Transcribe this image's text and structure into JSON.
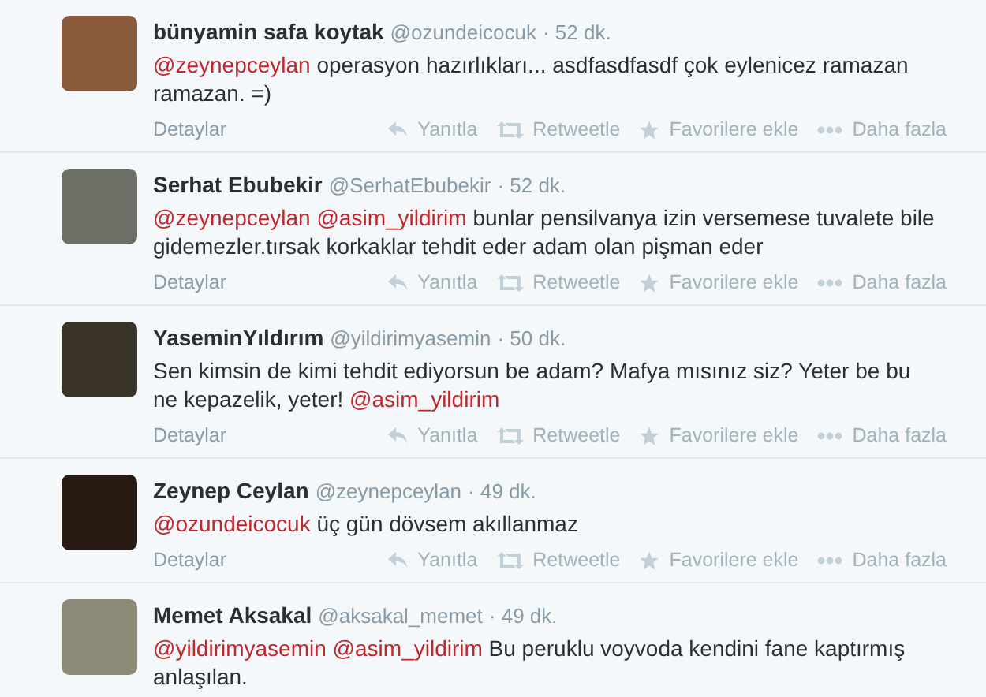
{
  "tweets": [
    {
      "name": "bünyamin safa koytak",
      "handle": "@ozundeicocuk",
      "time": "· 52 dk.",
      "body": [
        {
          "kind": "mention",
          "text": "@zeynepceylan"
        },
        {
          "kind": "text",
          "text": "operasyon hazırlıkları... asdfasdfasdf çok eylenicez ramazan ramazan. =)"
        }
      ],
      "details": "Detaylar",
      "actions": [
        {
          "kind": "reply",
          "label": "Yanıtla"
        },
        {
          "kind": "retweet",
          "label": "Retweetle"
        },
        {
          "kind": "favorite",
          "label": "Favorilere ekle"
        },
        {
          "kind": "more",
          "label": "Daha fazla"
        }
      ]
    },
    {
      "name": "Serhat Ebubekir",
      "handle": "@SerhatEbubekir",
      "time": "· 52 dk.",
      "body": [
        {
          "kind": "mention",
          "text": "@zeynepceylan"
        },
        {
          "kind": "mention",
          "text": "@asim_yildirim"
        },
        {
          "kind": "text",
          "text": "bunlar pensilvanya izin versemese tuvalete bile gidemezler.tırsak korkaklar tehdit eder adam olan pişman eder"
        }
      ],
      "details": "Detaylar",
      "actions": [
        {
          "kind": "reply",
          "label": "Yanıtla"
        },
        {
          "kind": "retweet",
          "label": "Retweetle"
        },
        {
          "kind": "favorite",
          "label": "Favorilere ekle"
        },
        {
          "kind": "more",
          "label": "Daha fazla"
        }
      ]
    },
    {
      "name": "YaseminYıldırım",
      "handle": "@yildirimyasemin",
      "time": "· 50 dk.",
      "body": [
        {
          "kind": "text",
          "text": "Sen kimsin de kimi tehdit ediyorsun be adam? Mafya mısınız siz? Yeter be bu ne kepazelik, yeter!"
        },
        {
          "kind": "mention",
          "text": "@asim_yildirim"
        }
      ],
      "details": "Detaylar",
      "actions": [
        {
          "kind": "reply",
          "label": "Yanıtla"
        },
        {
          "kind": "retweet",
          "label": "Retweetle"
        },
        {
          "kind": "favorite",
          "label": "Favorilere ekle"
        },
        {
          "kind": "more",
          "label": "Daha fazla"
        }
      ]
    },
    {
      "name": "Zeynep Ceylan",
      "handle": "@zeynepceylan",
      "time": "· 49 dk.",
      "body": [
        {
          "kind": "mention",
          "text": "@ozundeicocuk"
        },
        {
          "kind": "text",
          "text": "üç gün dövsem akıllanmaz"
        }
      ],
      "details": "Detaylar",
      "actions": [
        {
          "kind": "reply",
          "label": "Yanıtla"
        },
        {
          "kind": "retweet",
          "label": "Retweetle"
        },
        {
          "kind": "favorite",
          "label": "Favorilere ekle"
        },
        {
          "kind": "more",
          "label": "Daha fazla"
        }
      ]
    },
    {
      "name": "Memet Aksakal",
      "handle": "@aksakal_memet",
      "time": "· 49 dk.",
      "body": [
        {
          "kind": "mention",
          "text": "@yildirimyasemin"
        },
        {
          "kind": "mention",
          "text": "@asim_yildirim"
        },
        {
          "kind": "text",
          "text": "Bu peruklu voyvoda kendini fane kaptırmış anlaşılan."
        }
      ]
    }
  ]
}
